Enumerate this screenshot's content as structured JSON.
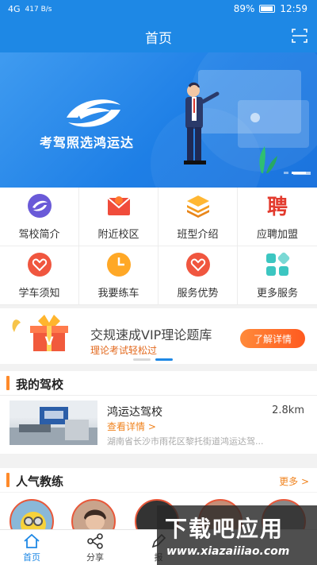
{
  "status": {
    "signal": "4G",
    "net_speed": "417 B/s",
    "battery": "89%",
    "time": "12:59"
  },
  "header": {
    "title": "首页",
    "scan_icon": "scan-icon"
  },
  "banner": {
    "slogan": "考驾照选鸿运达"
  },
  "menu": [
    {
      "label": "驾校简介",
      "icon": "school-logo-icon"
    },
    {
      "label": "附近校区",
      "icon": "map-pin-icon"
    },
    {
      "label": "班型介绍",
      "icon": "layers-icon"
    },
    {
      "label": "应聘加盟",
      "icon": "recruit-icon"
    },
    {
      "label": "学车须知",
      "icon": "heart-icon"
    },
    {
      "label": "我要练车",
      "icon": "clock-icon"
    },
    {
      "label": "服务优势",
      "icon": "heart-badge-icon"
    },
    {
      "label": "更多服务",
      "icon": "grid-icon"
    }
  ],
  "promo": {
    "title": "交规速成VIP理论题库",
    "subtitle": "理论考试轻松过",
    "button": "了解详情"
  },
  "my_school": {
    "section_title": "我的驾校",
    "name": "鸿运达驾校",
    "distance": "2.8km",
    "link": "查看详情 >",
    "address": "湖南省长沙市雨花区黎托街道鸿运达驾..."
  },
  "coaches": {
    "section_title": "人气教练",
    "more": "更多 >"
  },
  "tabbar": {
    "home": "首页",
    "share": "分享",
    "third": "报"
  },
  "watermark": {
    "big": "下载吧应用",
    "small": "www.xiazaiiiao.com"
  },
  "colors": {
    "primary": "#1e88e5",
    "accent": "#ff8a2a",
    "promo_orange": "#e36a1f"
  }
}
